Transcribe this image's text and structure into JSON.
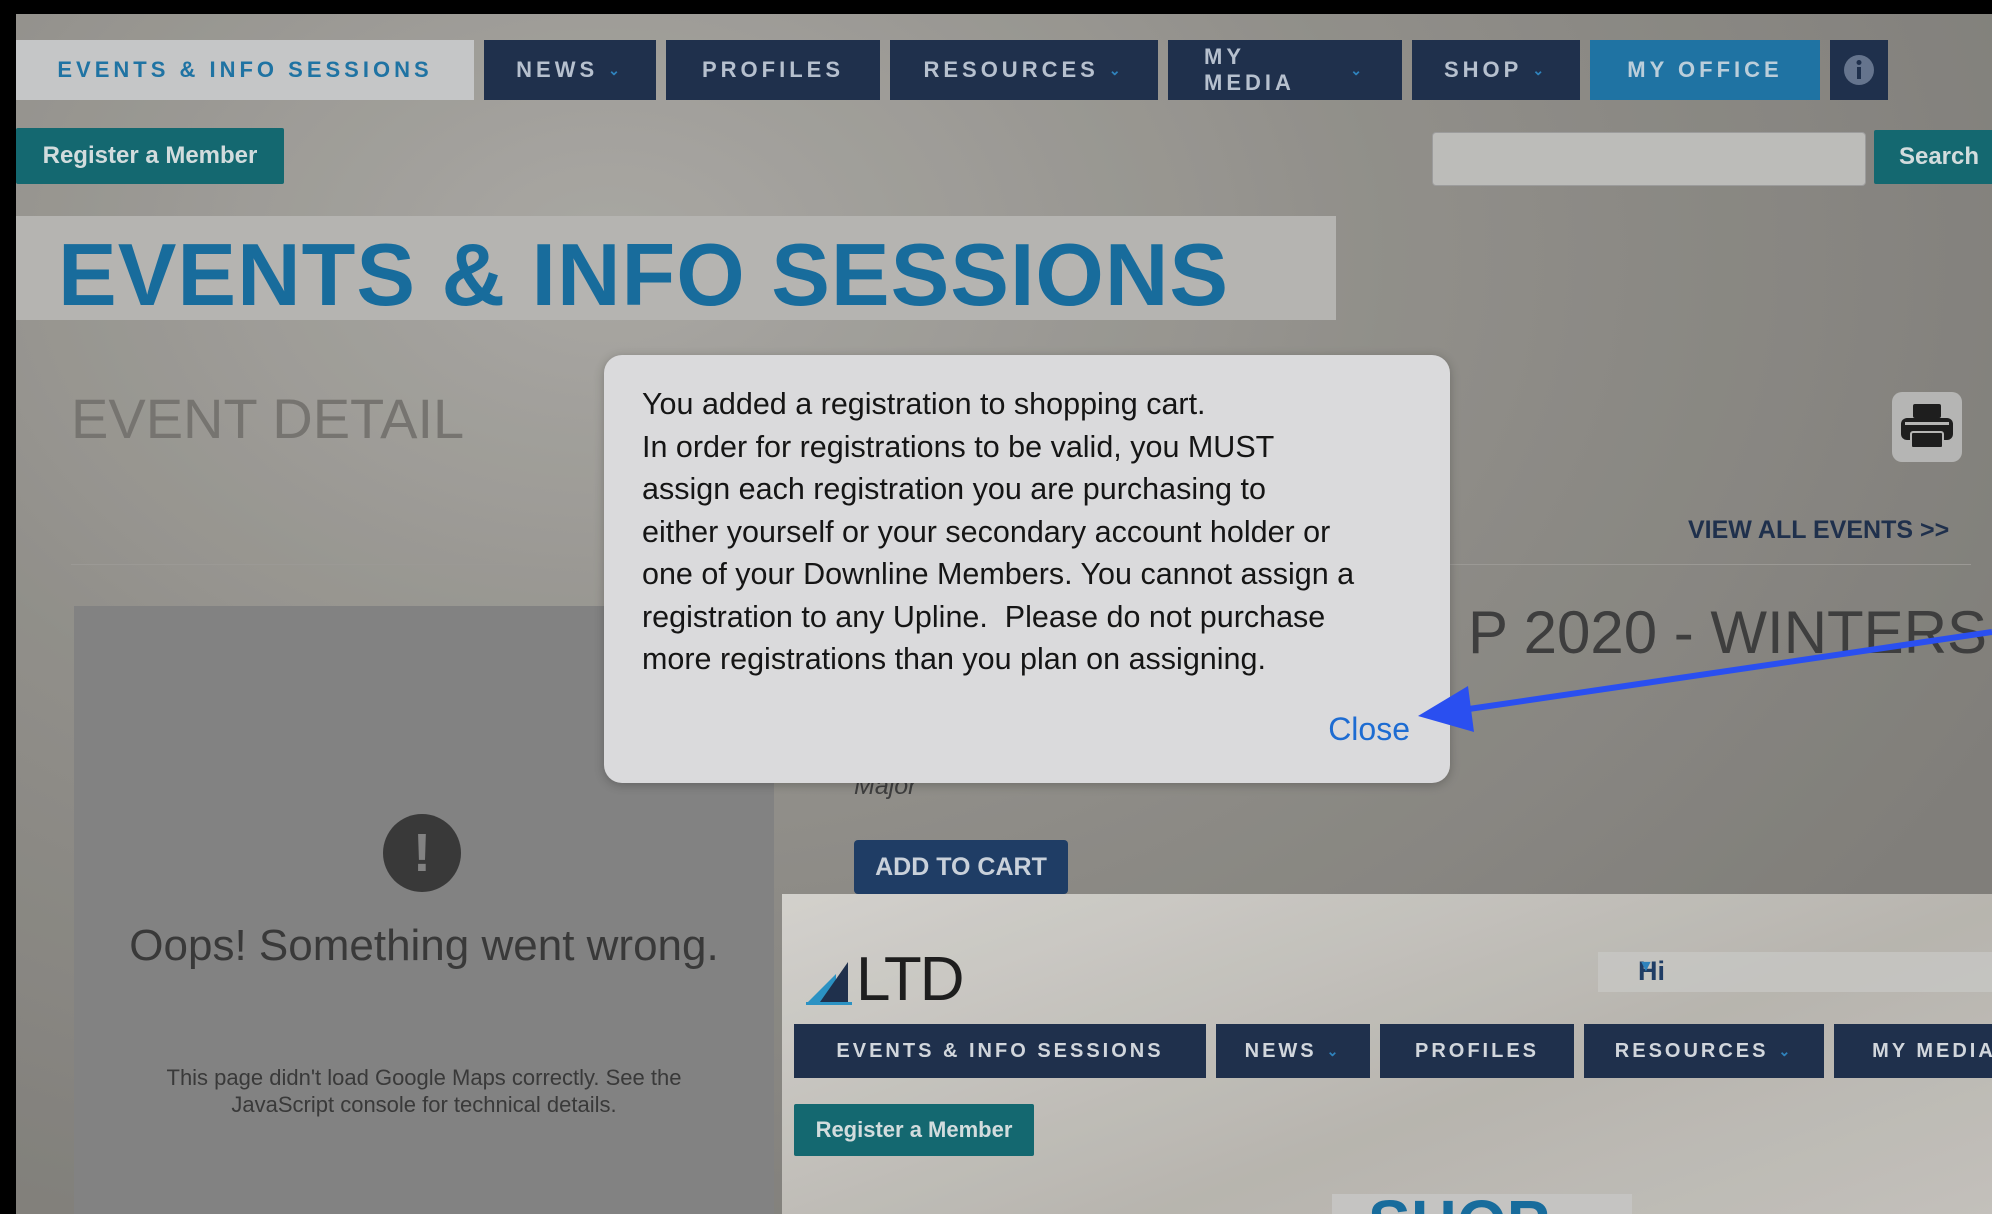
{
  "nav": {
    "items": [
      {
        "label": "EVENTS & INFO SESSIONS",
        "caret": ""
      },
      {
        "label": "NEWS",
        "caret": "⌄"
      },
      {
        "label": "PROFILES",
        "caret": ""
      },
      {
        "label": "RESOURCES",
        "caret": "⌄"
      },
      {
        "label": "MY MEDIA",
        "caret": "⌄"
      },
      {
        "label": "SHOP",
        "caret": "⌄"
      },
      {
        "label": "MY OFFICE",
        "caret": ""
      }
    ],
    "info_icon": "info-icon"
  },
  "toolbar": {
    "register_label": "Register a Member",
    "search_label": "Search",
    "search_value": ""
  },
  "hero": {
    "title": "EVENTS & INFO SESSIONS"
  },
  "detail": {
    "heading": "EVENT DETAIL",
    "view_all": "VIEW ALL EVENTS >>",
    "event_title_partial": "P 2020 - WINTERS",
    "level": "Major",
    "add_to_cart": "ADD TO CART"
  },
  "map_error": {
    "icon": "!",
    "title": "Oops! Something went wrong.",
    "message": "This page didn't load Google Maps correctly. See the JavaScript console for technical details."
  },
  "inset": {
    "logo_text": "LTD",
    "greeting": "Hi",
    "nav": [
      {
        "label": "EVENTS & INFO SESSIONS",
        "caret": ""
      },
      {
        "label": "NEWS",
        "caret": "⌄"
      },
      {
        "label": "PROFILES",
        "caret": ""
      },
      {
        "label": "RESOURCES",
        "caret": "⌄"
      },
      {
        "label": "MY MEDIA",
        "caret": ""
      }
    ],
    "register_label": "Register a Member",
    "shop_heading": "SHOP"
  },
  "modal": {
    "lines": [
      "You added a registration to shopping cart.",
      "In order for registrations to be valid, you MUST",
      "assign each registration you are purchasing to",
      "either yourself or your secondary account holder or",
      "one of your Downline Members. You cannot assign a",
      "registration to any Upline.  Please do not purchase",
      "more registrations than you plan on assigning."
    ],
    "close_label": "Close"
  },
  "colors": {
    "nav_bg": "#1c2f4f",
    "accent_blue": "#1473aa",
    "teal": "#0f6f78",
    "link_blue": "#1a73e8",
    "arrow": "#2a4ff0"
  }
}
